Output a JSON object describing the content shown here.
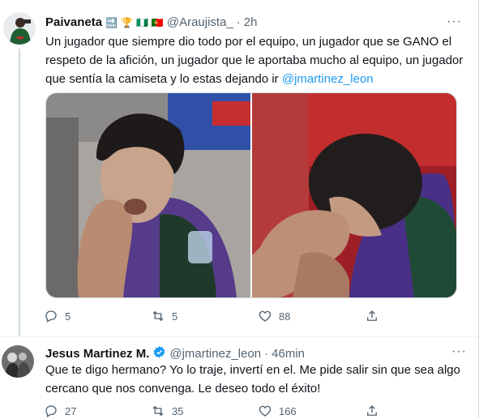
{
  "tweet1": {
    "name": "Paivaneta",
    "name_emojis": [
      "🔜",
      "🏆",
      "🇳🇬",
      "🇵🇹"
    ],
    "handle": "@Araujista_",
    "separator": "·",
    "time": "2h",
    "text_before": "Un jugador que siempre dio todo por el equipo, un jugador que se GANO el respeto de la afición, un jugador que le aportaba mucho al equipo, un jugador que sentía la camiseta y lo estas dejando ir ",
    "mention": "@jmartinez_leon",
    "replies": "5",
    "retweets": "5",
    "likes": "88",
    "more": "···"
  },
  "tweet2": {
    "name": "Jesus Martinez M.",
    "handle": "@jmartinez_leon",
    "separator": "·",
    "time": "46min",
    "text": "Que te digo hermano? Yo lo traje, invertí en el. Me pide salir sin que sea algo cercano que nos convenga. Le deseo todo el éxito!",
    "replies": "27",
    "retweets": "35",
    "likes": "166",
    "more": "···"
  },
  "colors": {
    "accent": "#1d9bf0",
    "text": "#0f1419",
    "secondary": "#536471",
    "border": "#cfd9de"
  },
  "icons": [
    "reply-icon",
    "retweet-icon",
    "like-icon",
    "share-icon",
    "verified-icon",
    "more-icon"
  ]
}
